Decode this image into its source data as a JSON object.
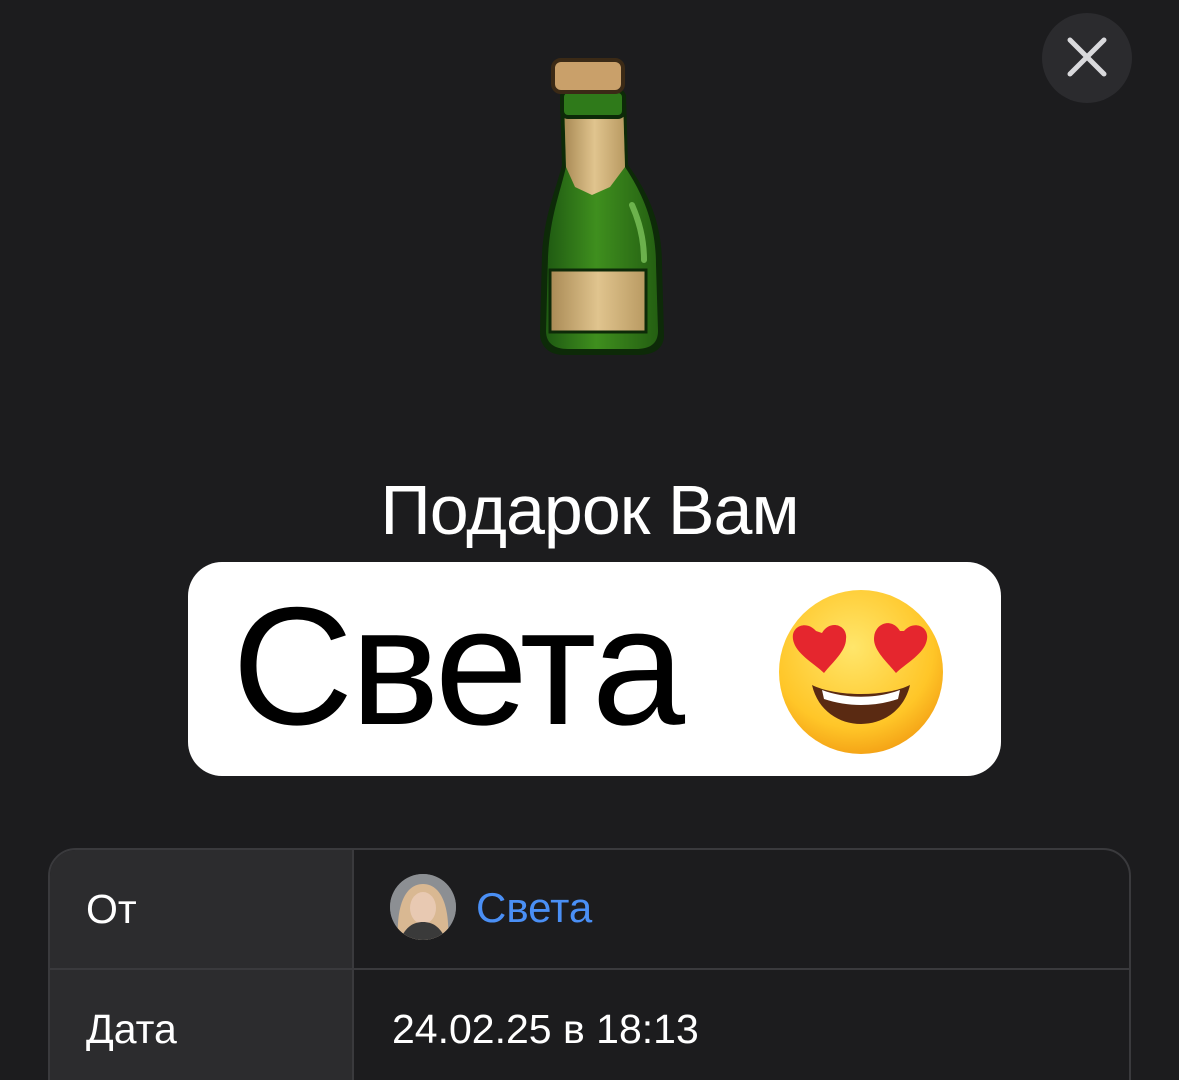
{
  "close_icon": "close-icon",
  "gift": {
    "sticker": "champagne-bottle-icon",
    "title": "Подарок Вам"
  },
  "highlight": {
    "name": "Света",
    "emoji": "smiling-face-with-heart-eyes-icon"
  },
  "details": {
    "from_label": "От",
    "from_name": "Света",
    "date_label": "Дата",
    "date_value": "24.02.25 в 18:13"
  },
  "colors": {
    "background": "#1c1c1e",
    "label_cell": "#2c2c2e",
    "link": "#4a8ff5",
    "border": "#3a3a3d"
  }
}
